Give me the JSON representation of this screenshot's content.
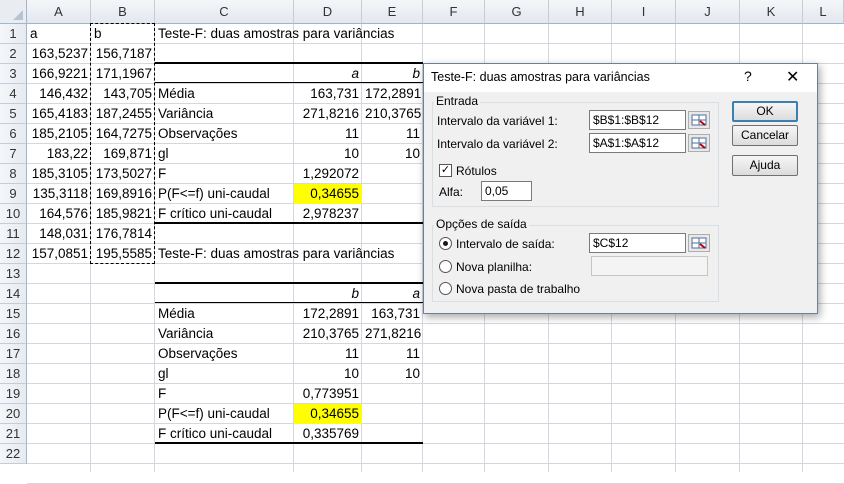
{
  "columns": [
    "A",
    "B",
    "C",
    "D",
    "E",
    "F",
    "G",
    "H",
    "I",
    "J",
    "K",
    "L"
  ],
  "rows": [
    "1",
    "2",
    "3",
    "4",
    "5",
    "6",
    "7",
    "8",
    "9",
    "10",
    "11",
    "12",
    "13",
    "14",
    "15",
    "16",
    "17",
    "18",
    "19",
    "20",
    "21",
    "22"
  ],
  "colA": [
    "a",
    "163,5237",
    "166,9221",
    "146,432",
    "165,4183",
    "185,2105",
    "183,22",
    "185,3105",
    "135,3118",
    "164,576",
    "148,031",
    "157,0851"
  ],
  "colB": [
    "b",
    "156,7187",
    "171,1967",
    "143,705",
    "187,2455",
    "164,7275",
    "169,871",
    "173,5027",
    "169,8916",
    "185,9821",
    "176,7814",
    "195,5585"
  ],
  "table1": {
    "title": "Teste-F: duas amostras para variâncias",
    "head_d": "a",
    "head_e": "b",
    "labels": [
      "Média",
      "Variância",
      "Observações",
      "gl",
      "F",
      "P(F<=f) uni-caudal",
      "F crítico uni-caudal"
    ],
    "d": [
      "163,731",
      "271,8216",
      "11",
      "10",
      "1,292072",
      "0,34655",
      "2,978237"
    ],
    "e": [
      "172,2891",
      "210,3765",
      "11",
      "10",
      "",
      "",
      ""
    ]
  },
  "table2": {
    "title": "Teste-F: duas amostras para variâncias",
    "head_d": "b",
    "head_e": "a",
    "labels": [
      "Média",
      "Variância",
      "Observações",
      "gl",
      "F",
      "P(F<=f) uni-caudal",
      "F crítico uni-caudal"
    ],
    "d": [
      "172,2891",
      "210,3765",
      "11",
      "10",
      "0,773951",
      "0,34655",
      "0,335769"
    ],
    "e": [
      "163,731",
      "271,8216",
      "11",
      "10",
      "",
      "",
      ""
    ]
  },
  "dialog": {
    "title": "Teste-F: duas amostras para variâncias",
    "help": "?",
    "close": "✕",
    "entrada_label": "Entrada",
    "var1_label": "Intervalo da variável 1:",
    "var1_value": "$B$1:$B$12",
    "var2_label": "Intervalo da variável 2:",
    "var2_value": "$A$1:$A$12",
    "rotulos_label": "Rótulos",
    "rotulos_checked": true,
    "alfa_label": "Alfa:",
    "alfa_value": "0,05",
    "saida_label": "Opções de saída",
    "intervalo_saida_label": "Intervalo de saída:",
    "intervalo_saida_value": "$C$12",
    "nova_planilha_label": "Nova planilha:",
    "nova_pasta_label": "Nova pasta de trabalho",
    "ok_label": "OK",
    "cancel_label": "Cancelar",
    "help_label": "Ajuda"
  },
  "colors": {
    "highlight": "#ffff00",
    "header_bg": "#e3e8ef",
    "dialog_bg": "#f0f0f0"
  }
}
